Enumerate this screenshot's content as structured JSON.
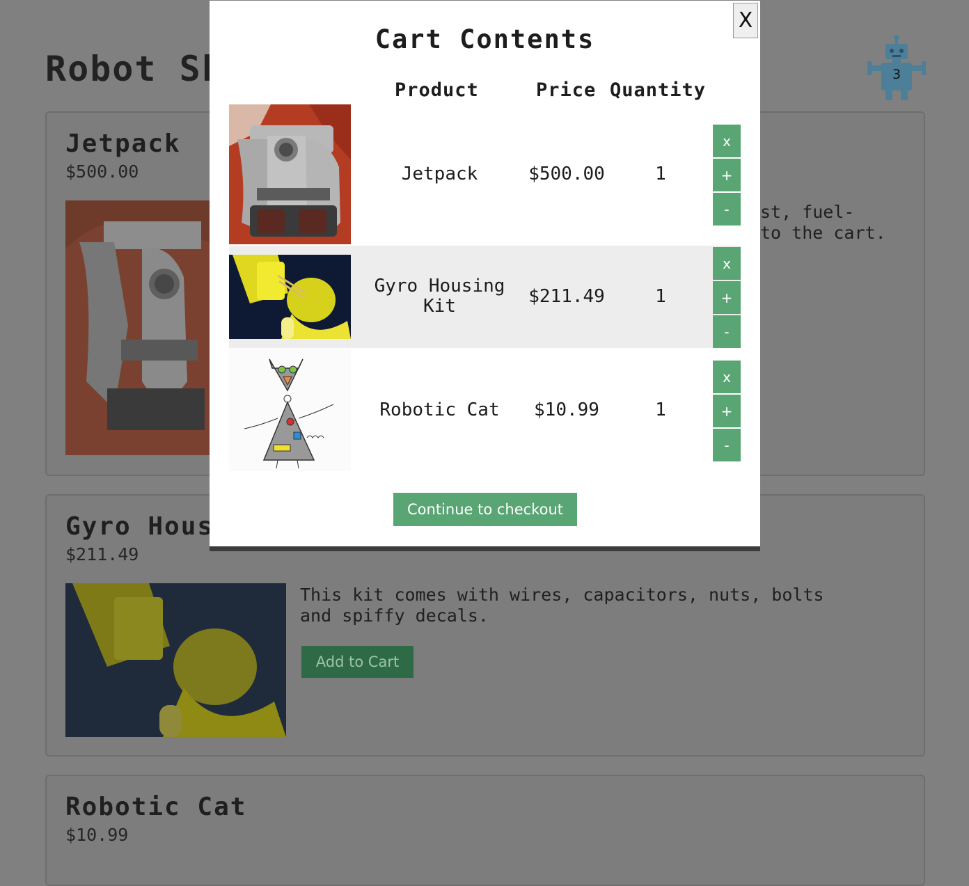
{
  "page": {
    "title": "Robot Sh",
    "cart_count": "3"
  },
  "products": [
    {
      "name": "Jetpack",
      "price": "$500.00",
      "desc": "st, fuel-\nto the cart."
    },
    {
      "name": "Gyro Hous",
      "price": "$211.49",
      "desc": "This kit comes with wires, capacitors, nuts, bolts\nand spiffy decals.",
      "add_label": "Add to Cart"
    },
    {
      "name": "Robotic Cat",
      "price": "$10.99"
    }
  ],
  "modal": {
    "close_label": "X",
    "title": "Cart Contents",
    "headers": {
      "product": "Product",
      "price": "Price",
      "quantity": "Quantity"
    },
    "rows": [
      {
        "name": "Jetpack",
        "price": "$500.00",
        "qty": "1"
      },
      {
        "name": "Gyro Housing Kit",
        "price": "$211.49",
        "qty": "1"
      },
      {
        "name": "Robotic Cat",
        "price": "$10.99",
        "qty": "1"
      }
    ],
    "actions": {
      "remove": "x",
      "increase": "+",
      "decrease": "-"
    },
    "checkout_label": "Continue to checkout"
  },
  "colors": {
    "accent": "#5aa574",
    "backdrop": "#808080",
    "alt_row": "#ededed"
  }
}
